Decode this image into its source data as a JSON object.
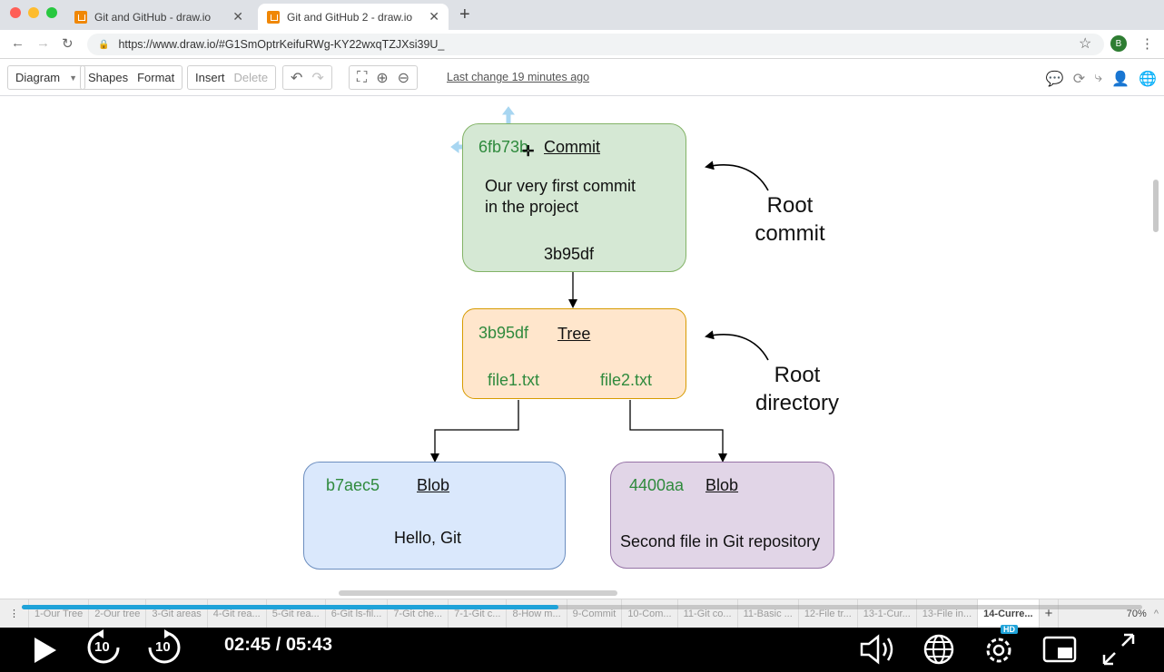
{
  "browser": {
    "tabs": [
      {
        "title": "Git and GitHub - draw.io",
        "active": false
      },
      {
        "title": "Git and GitHub 2 - draw.io",
        "active": true
      }
    ],
    "url": "https://www.draw.io/#G1SmOptrKeifuRWg-KY22wxqTZJXsi39U_",
    "profile_initial": "B"
  },
  "toolbar": {
    "diagram_label": "Diagram",
    "shapes_label": "Shapes",
    "format_label": "Format",
    "insert_label": "Insert",
    "delete_label": "Delete",
    "last_change": "Last change 19 minutes ago"
  },
  "diagram": {
    "commit": {
      "hash": "6fb73b",
      "type": "Commit",
      "message_line1": "Our very first commit",
      "message_line2": "in the project",
      "tree_ref": "3b95df"
    },
    "tree": {
      "hash": "3b95df",
      "type": "Tree",
      "file1": "file1.txt",
      "file2": "file2.txt"
    },
    "blob1": {
      "hash": "b7aec5",
      "type": "Blob",
      "content": "Hello, Git"
    },
    "blob2": {
      "hash": "4400aa",
      "type": "Blob",
      "content": "Second file in Git repository"
    },
    "annotation_commit_line1": "Root",
    "annotation_commit_line2": "commit",
    "annotation_tree_line1": "Root",
    "annotation_tree_line2": "directory"
  },
  "pages": [
    {
      "label": "1-Our Tree"
    },
    {
      "label": "2-Our tree"
    },
    {
      "label": "3-Git areas"
    },
    {
      "label": "4-Git rea..."
    },
    {
      "label": "5-Git rea..."
    },
    {
      "label": "6-Git ls-fil..."
    },
    {
      "label": "7-Git che..."
    },
    {
      "label": "7-1-Git c..."
    },
    {
      "label": "8-How m..."
    },
    {
      "label": "9-Commit"
    },
    {
      "label": "10-Com..."
    },
    {
      "label": "11-Git co..."
    },
    {
      "label": "11-Basic ..."
    },
    {
      "label": "12-File tr..."
    },
    {
      "label": "13-1-Cur..."
    },
    {
      "label": "13-File in..."
    },
    {
      "label": "14-Curre..."
    }
  ],
  "zoom": "70%",
  "player": {
    "time": "02:45 / 05:43",
    "progress": 0.479,
    "rewind_label": "10",
    "forward_label": "10",
    "hd_badge": "HD",
    "accent": "#1fa3d9"
  },
  "colors": {
    "commit_fill": "#d5e8d4",
    "commit_stroke": "#82b366",
    "tree_fill": "#ffe6cc",
    "tree_stroke": "#d79b00",
    "blob1_fill": "#dae8fc",
    "blob1_stroke": "#6c8ebf",
    "blob2_fill": "#e1d5e7",
    "blob2_stroke": "#9673a6",
    "hash_green": "#2f8a3d"
  }
}
